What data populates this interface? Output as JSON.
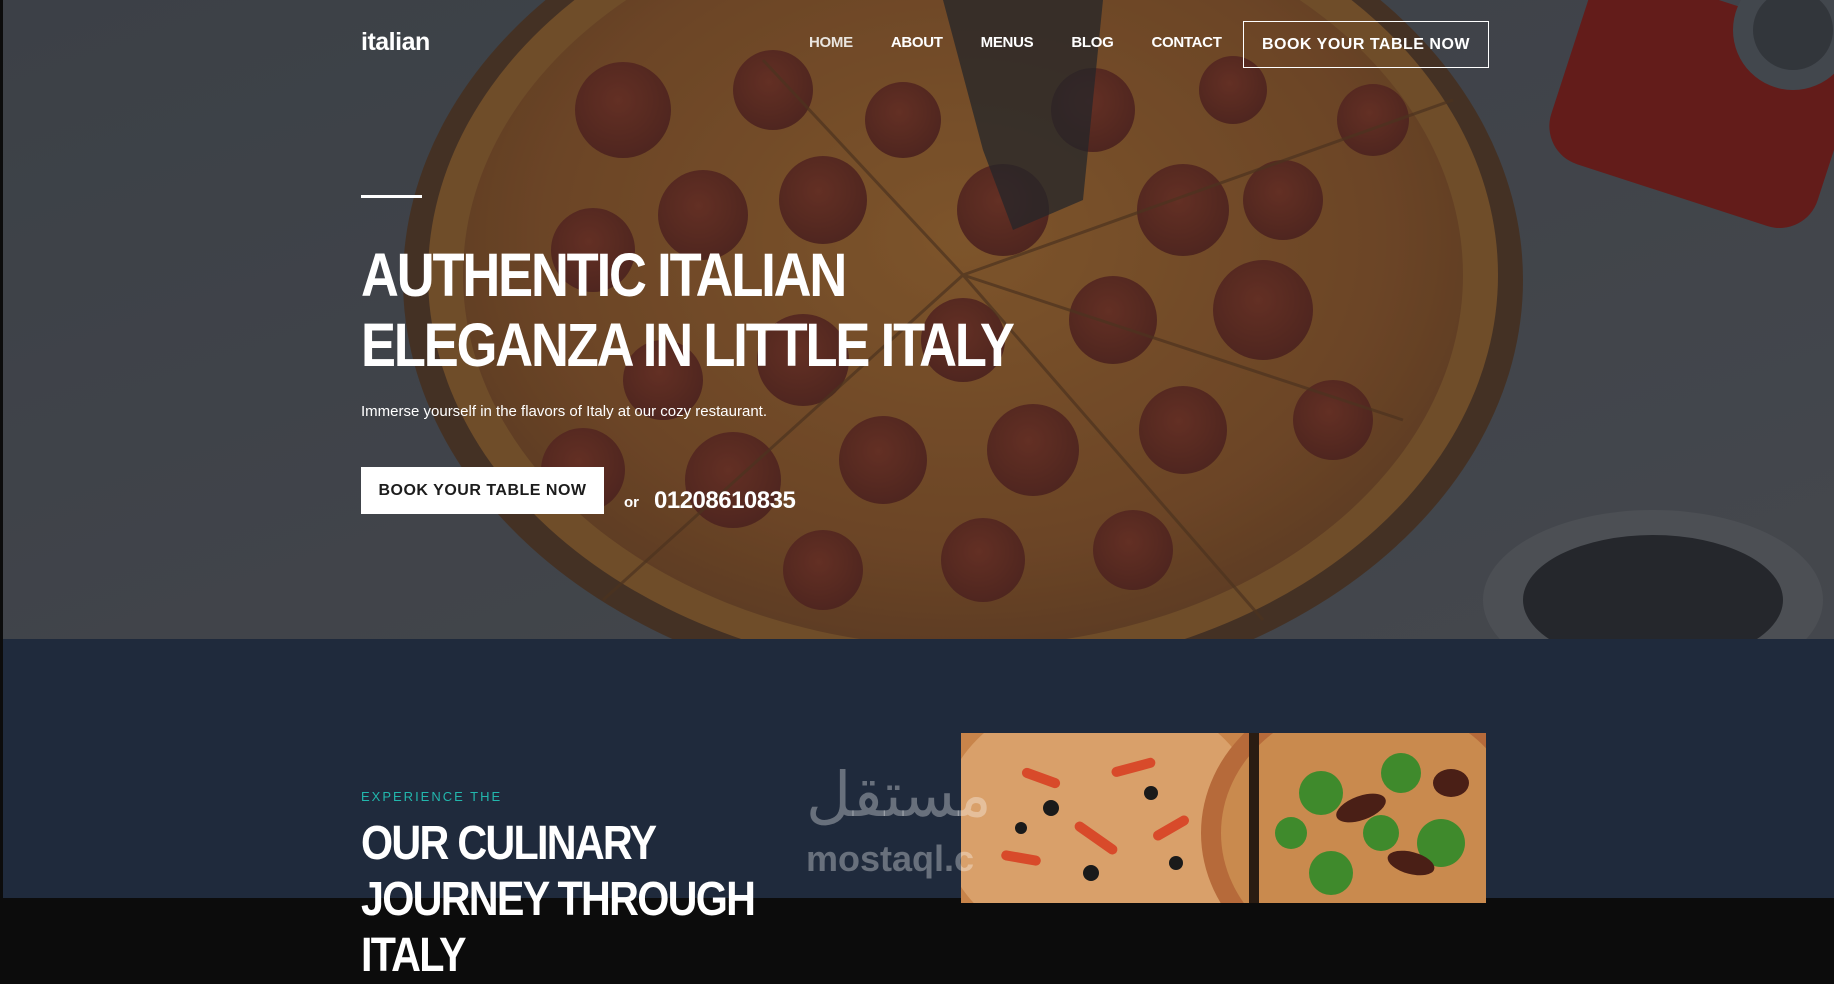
{
  "header": {
    "logo": "italian",
    "nav": [
      "HOME",
      "ABOUT",
      "MENUS",
      "BLOG",
      "CONTACT"
    ],
    "cta_label": "BOOK YOUR TABLE NOW"
  },
  "hero": {
    "title": "AUTHENTIC ITALIAN ELEGANZA IN LITTLE ITALY",
    "subtitle": "Immerse yourself in the flavors of Italy at our cozy restaurant.",
    "cta_label": "BOOK YOUR TABLE NOW",
    "or_text": "or",
    "phone": "01208610835",
    "background_image": "pepperoni-pizza-photo"
  },
  "about": {
    "eyebrow": "EXPERIENCE THE",
    "title": "OUR CULINARY JOURNEY THROUGH ITALY",
    "image": "two-pizzas-photo"
  },
  "watermark": {
    "arabic": "مستقل",
    "latin": "mostaql.c"
  },
  "colors": {
    "section_bg": "#1f2a3c",
    "accent_teal": "#22b7ad",
    "white": "#ffffff"
  }
}
